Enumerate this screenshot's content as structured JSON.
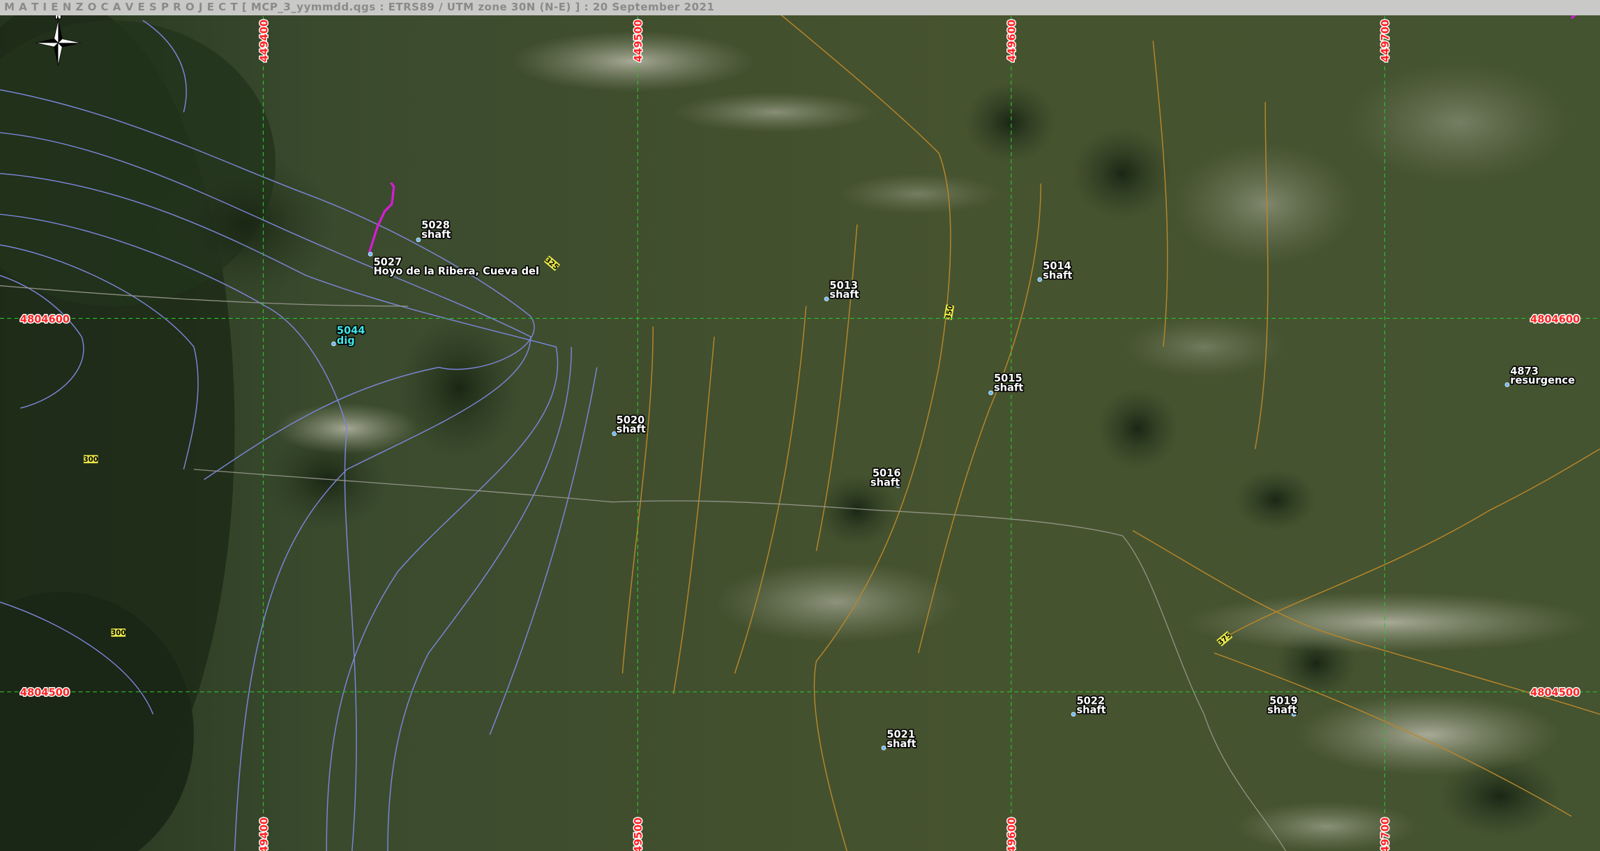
{
  "header": {
    "title": "M A T I E N Z O   C A V E S   P R O J E C T  [ MCP_3_yymmdd.qgs : ETRS89 / UTM zone 30N (N-E) ] : 20 September 2021"
  },
  "north_arrow": {
    "label": "N"
  },
  "grid": {
    "vertical_labels": [
      "449400",
      "449500",
      "449600",
      "449700"
    ],
    "horizontal_labels": [
      "4804600",
      "4804500"
    ]
  },
  "contours": {
    "labels": [
      "325",
      "350",
      "300",
      "300",
      "375"
    ]
  },
  "colors": {
    "grid": "#2fbf2f",
    "grid_label": "#ff2222",
    "contour_blue": "#7b86d8",
    "contour_orange": "#b9862a",
    "survey_line": "#d81bd8",
    "cave_point": "#6ab8ff",
    "dig_label": "#3fe8e8"
  },
  "sites": [
    {
      "id": "5028",
      "type": "shaft"
    },
    {
      "id": "5027",
      "type": "Hoyo de la Ribera, Cueva del"
    },
    {
      "id": "5044",
      "type": "dig"
    },
    {
      "id": "5013",
      "type": "shaft"
    },
    {
      "id": "5014",
      "type": "shaft"
    },
    {
      "id": "5015",
      "type": "shaft"
    },
    {
      "id": "5020",
      "type": "shaft"
    },
    {
      "id": "5016",
      "type": "shaft"
    },
    {
      "id": "4873",
      "type": "resurgence"
    },
    {
      "id": "5022",
      "type": "shaft"
    },
    {
      "id": "5019",
      "type": "shaft"
    },
    {
      "id": "5021",
      "type": "shaft"
    },
    {
      "id": "",
      "type": "shaft"
    }
  ]
}
